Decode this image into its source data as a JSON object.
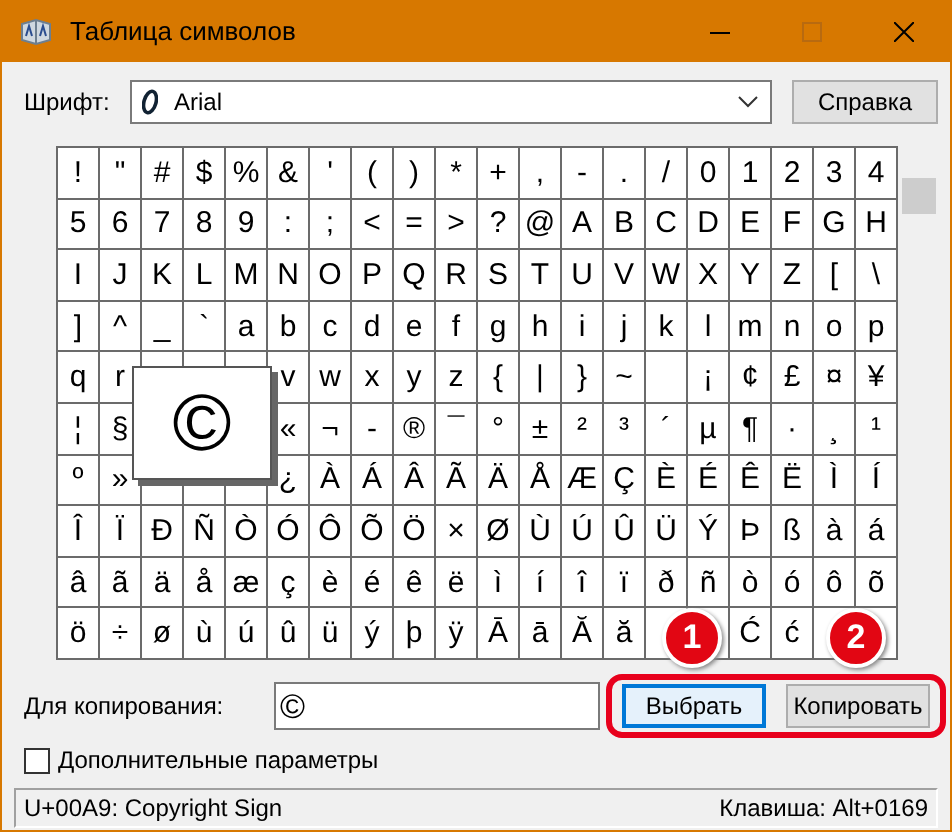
{
  "window": {
    "title": "Таблица символов"
  },
  "font": {
    "label": "Шрифт:",
    "value": "Arial",
    "help_button": "Справка"
  },
  "grid": {
    "rows": [
      [
        "!",
        "\"",
        "#",
        "$",
        "%",
        "&",
        "'",
        "(",
        ")",
        "*",
        "+",
        ",",
        "-",
        ".",
        "/",
        "0",
        "1",
        "2",
        "3",
        "4"
      ],
      [
        "5",
        "6",
        "7",
        "8",
        "9",
        ":",
        ";",
        "<",
        "=",
        ">",
        "?",
        "@",
        "A",
        "B",
        "C",
        "D",
        "E",
        "F",
        "G",
        "H"
      ],
      [
        "I",
        "J",
        "K",
        "L",
        "M",
        "N",
        "O",
        "P",
        "Q",
        "R",
        "S",
        "T",
        "U",
        "V",
        "W",
        "X",
        "Y",
        "Z",
        "[",
        "\\"
      ],
      [
        "]",
        "^",
        "_",
        "`",
        "a",
        "b",
        "c",
        "d",
        "e",
        "f",
        "g",
        "h",
        "i",
        "j",
        "k",
        "l",
        "m",
        "n",
        "o",
        "p"
      ],
      [
        "q",
        "r",
        null,
        null,
        null,
        "v",
        "w",
        "x",
        "y",
        "z",
        "{",
        "|",
        "}",
        "~",
        null,
        "¡",
        "¢",
        "£",
        "¤",
        "¥"
      ],
      [
        "¦",
        "§",
        null,
        null,
        null,
        "«",
        "¬",
        "-",
        "®",
        "¯",
        "°",
        "±",
        "²",
        "³",
        "´",
        "µ",
        "¶",
        "·",
        "¸",
        "¹"
      ],
      [
        "º",
        "»",
        null,
        null,
        null,
        "¿",
        "À",
        "Á",
        "Â",
        "Ã",
        "Ä",
        "Å",
        "Æ",
        "Ç",
        "È",
        "É",
        "Ê",
        "Ë",
        "Ì",
        "Í"
      ],
      [
        "Î",
        "Ï",
        "Ð",
        "Ñ",
        "Ò",
        "Ó",
        "Ô",
        "Õ",
        "Ö",
        "×",
        "Ø",
        "Ù",
        "Ú",
        "Û",
        "Ü",
        "Ý",
        "Þ",
        "ß",
        "à",
        "á"
      ],
      [
        "â",
        "ã",
        "ä",
        "å",
        "æ",
        "ç",
        "è",
        "é",
        "ê",
        "ë",
        "ì",
        "í",
        "î",
        "ï",
        "ð",
        "ñ",
        "ò",
        "ó",
        "ô",
        "õ"
      ],
      [
        "ö",
        "÷",
        "ø",
        "ù",
        "ú",
        "û",
        "ü",
        "ý",
        "þ",
        "ÿ",
        "Ā",
        "ā",
        "Ă",
        "ă",
        null,
        null,
        "Ć",
        "ć",
        null,
        null
      ]
    ],
    "magnified": "©"
  },
  "copy": {
    "label": "Для копирования:",
    "value": "©",
    "select_button": "Выбрать",
    "copy_button": "Копировать"
  },
  "advanced": {
    "label": "Дополнительные параметры",
    "checked": false
  },
  "callouts": [
    {
      "label": "1"
    },
    {
      "label": "2"
    }
  ],
  "status_bar": {
    "character": "U+00A9: Copyright Sign",
    "keystroke": "Клавиша: Alt+0169"
  }
}
